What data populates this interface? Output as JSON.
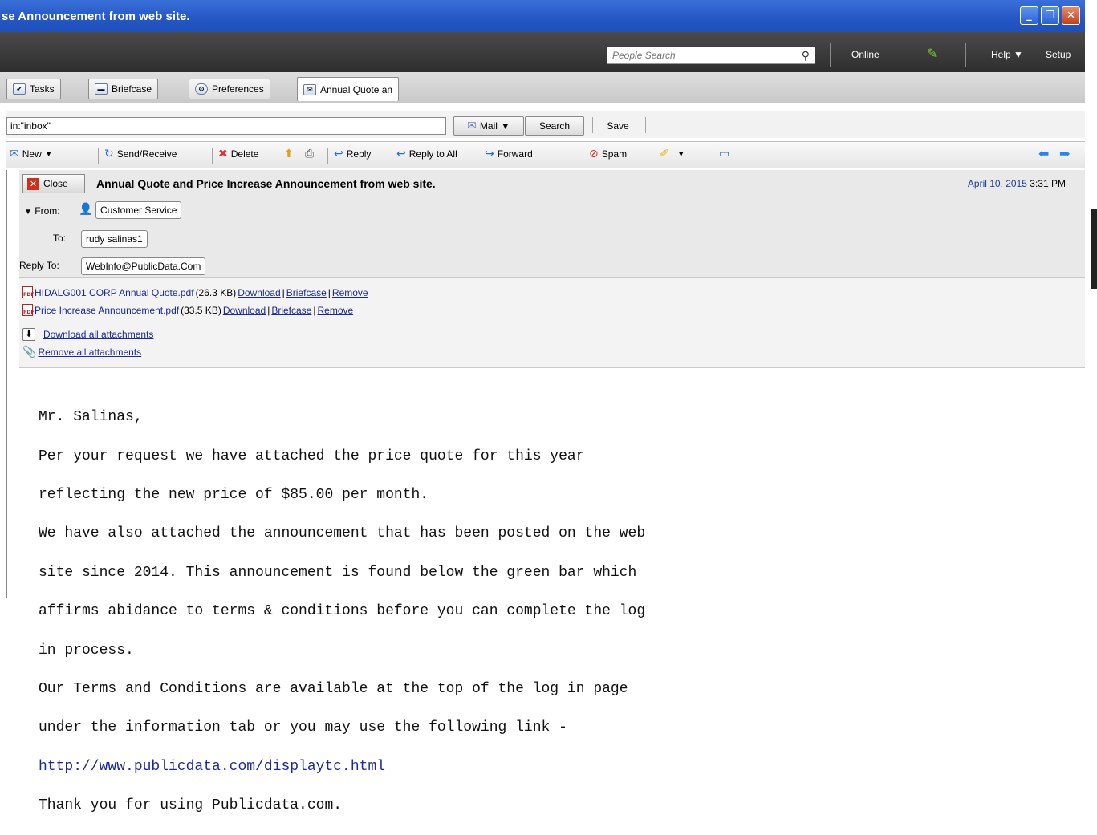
{
  "window": {
    "title": "se Announcement from web site."
  },
  "topbar": {
    "search_placeholder": "People Search",
    "status": "Online",
    "help_label": "Help",
    "setup_label": "Setup"
  },
  "tabs": [
    {
      "label": "Tasks",
      "icon": "checkbox-icon"
    },
    {
      "label": "Briefcase",
      "icon": "briefcase-icon"
    },
    {
      "label": "Preferences",
      "icon": "gear-icon"
    },
    {
      "label": "Annual Quote an",
      "icon": "envelope-icon"
    }
  ],
  "search": {
    "query": "in:\"inbox\"",
    "type_label": "Mail",
    "search_label": "Search",
    "save_label": "Save"
  },
  "toolbar": {
    "new_label": "New",
    "send_receive_label": "Send/Receive",
    "delete_label": "Delete",
    "reply_label": "Reply",
    "reply_all_label": "Reply to All",
    "forward_label": "Forward",
    "spam_label": "Spam"
  },
  "message": {
    "close_label": "Close",
    "subject": "Annual Quote and Price Increase Announcement from web site.",
    "date": "April 10, 2015",
    "time": "3:31 PM",
    "from_label": "From:",
    "from": "Customer Service",
    "to_label": "To:",
    "to": "rudy salinas1",
    "reply_to_label": "Reply To:",
    "reply_to": "WebInfo@PublicData.Com"
  },
  "attachments": {
    "files": [
      {
        "name": "HIDALG001 CORP Annual Quote.pdf",
        "size": "(26.3 KB)"
      },
      {
        "name": "Price Increase Announcement.pdf",
        "size": "(33.5 KB)"
      }
    ],
    "download": "Download",
    "briefcase": "Briefcase",
    "remove": "Remove",
    "separator": "|",
    "download_all": "Download all attachments",
    "remove_all": "Remove all attachments"
  },
  "body": {
    "lines": [
      "Mr. Salinas,",
      "Per your request we have attached the price quote for this year",
      "reflecting the new price of $85.00 per month.",
      "We have also attached the announcement that has been posted on the web",
      "site since 2014. This announcement is found below the green bar which",
      "affirms abidance to terms & conditions before you can complete the log",
      "in process.",
      "Our Terms and Conditions are available at the top of the log in page",
      "under the information tab or you may use the following link -",
      "http://www.publicdata.com/displaytc.html",
      "Thank you for using Publicdata.com."
    ]
  }
}
